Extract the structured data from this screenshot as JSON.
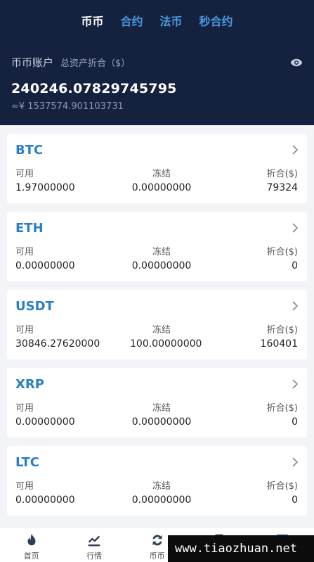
{
  "tabs": [
    {
      "label": "币币",
      "active": true
    },
    {
      "label": "合约",
      "active": false
    },
    {
      "label": "法币",
      "active": false
    },
    {
      "label": "秒合约",
      "active": false
    }
  ],
  "account": {
    "label": "币币账户",
    "sub_label": "总资产折合（$）",
    "total": "240246.07829745795",
    "approx": "≈¥ 1537574.901103731"
  },
  "columns": {
    "available": "可用",
    "frozen": "冻结",
    "equivalent": "折合($)"
  },
  "assets": [
    {
      "coin": "BTC",
      "available": "1.97000000",
      "frozen": "0.00000000",
      "equivalent": "79324"
    },
    {
      "coin": "ETH",
      "available": "0.00000000",
      "frozen": "0.00000000",
      "equivalent": "0"
    },
    {
      "coin": "USDT",
      "available": "30846.27620000",
      "frozen": "100.00000000",
      "equivalent": "160401"
    },
    {
      "coin": "XRP",
      "available": "0.00000000",
      "frozen": "0.00000000",
      "equivalent": "0"
    },
    {
      "coin": "LTC",
      "available": "0.00000000",
      "frozen": "0.00000000",
      "equivalent": "0"
    }
  ],
  "bottom_nav": [
    {
      "label": "首页",
      "icon": "flame-icon"
    },
    {
      "label": "行情",
      "icon": "chart-icon"
    },
    {
      "label": "币币",
      "icon": "exchange-icon"
    },
    {
      "label": "",
      "icon": "wallet-icon"
    },
    {
      "label": "",
      "icon": "user-icon"
    }
  ],
  "watermark": "www.tiaozhuan.net",
  "colors": {
    "header_bg": "#15223f",
    "accent": "#2a7fc4",
    "tab_inactive": "#4a9ae0"
  }
}
